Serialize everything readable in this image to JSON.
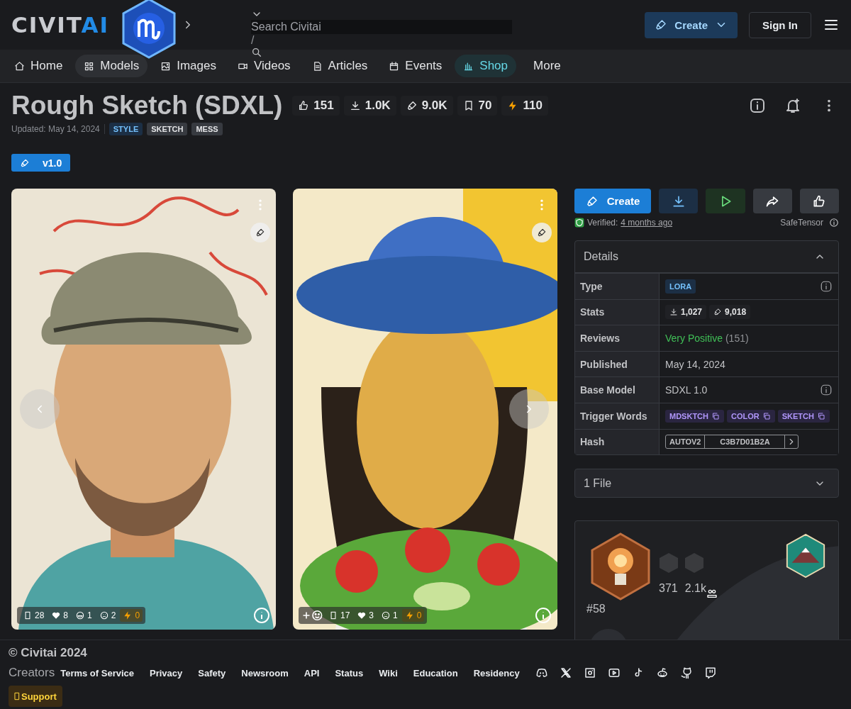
{
  "header": {
    "logo": {
      "main": "CIVIT",
      "accent": "AI"
    },
    "search": {
      "placeholder": "Search Civitai",
      "shortcut": "/"
    },
    "create_label": "Create",
    "sign_in_label": "Sign In"
  },
  "nav": [
    {
      "label": "Home",
      "kind": "plain",
      "selected": false
    },
    {
      "label": "Models",
      "kind": "plain",
      "selected": true
    },
    {
      "label": "Images",
      "kind": "plain",
      "selected": false
    },
    {
      "label": "Videos",
      "kind": "plain",
      "selected": false
    },
    {
      "label": "Articles",
      "kind": "plain",
      "selected": false
    },
    {
      "label": "Events",
      "kind": "plain",
      "selected": false
    },
    {
      "label": "Shop",
      "kind": "highlight",
      "selected": false
    },
    {
      "label": "More",
      "kind": "menu",
      "selected": false
    }
  ],
  "model": {
    "title": "Rough Sketch (SDXL)",
    "stats": [
      "151",
      "1.0K",
      "9.0K",
      "70",
      "110"
    ],
    "updated": "Updated: May 14, 2024",
    "tags": [
      {
        "label": "STYLE",
        "kind": "category"
      },
      {
        "label": "SKETCH",
        "kind": "tag"
      },
      {
        "label": "MESS",
        "kind": "tag"
      }
    ],
    "versions": [
      {
        "label": "v1.0",
        "selected": true
      }
    ]
  },
  "gallery": [
    {
      "add_reaction": false,
      "reactions": [
        {
          "kind": "unknown",
          "count": "28"
        },
        {
          "kind": "heart",
          "count": "8"
        },
        {
          "kind": "laugh",
          "count": "1"
        },
        {
          "kind": "cry",
          "count": "2"
        },
        {
          "kind": "buzz",
          "count": "0"
        }
      ]
    },
    {
      "add_reaction": true,
      "reactions": [
        {
          "kind": "unknown",
          "count": "17"
        },
        {
          "kind": "heart",
          "count": "3"
        },
        {
          "kind": "cry",
          "count": "1"
        },
        {
          "kind": "buzz",
          "count": "0"
        }
      ]
    }
  ],
  "actions": {
    "create_label": "Create",
    "buttons": [
      {
        "kind": "download"
      },
      {
        "kind": "play"
      },
      {
        "kind": "share"
      },
      {
        "kind": "like"
      }
    ]
  },
  "verified": {
    "label": "Verified:",
    "time": "4 months ago",
    "format": "SafeTensor"
  },
  "details": {
    "title": "Details",
    "expanded": true,
    "rows": [
      {
        "label": "Type",
        "kind": "badge",
        "value": "LORA",
        "info": true
      },
      {
        "label": "Stats",
        "kind": "stats",
        "info": false,
        "items": [
          "1,027",
          "9,018"
        ]
      },
      {
        "label": "Reviews",
        "kind": "review",
        "value": "Very Positive",
        "count": "(151)",
        "info": false
      },
      {
        "label": "Published",
        "kind": "text",
        "value": "May 14, 2024",
        "info": false
      },
      {
        "label": "Base Model",
        "kind": "text",
        "value": "SDXL 1.0",
        "info": true
      },
      {
        "label": "Trigger Words",
        "kind": "chips",
        "items": [
          "MDSKTCH",
          "COLOR",
          "SKETCH"
        ],
        "info": false
      },
      {
        "label": "Hash",
        "kind": "hash",
        "hash_type": "AUTOV2",
        "value": "C3B7D01B2A",
        "info": false
      }
    ]
  },
  "files": {
    "label": "1 File",
    "expanded": false
  },
  "creator": {
    "rank": "#58",
    "stats": [
      "371",
      "2.1k"
    ]
  },
  "footer": {
    "copyright": "© Civitai 2024",
    "creators": "Creators",
    "links": [
      "Terms of Service",
      "Privacy",
      "Safety",
      "Newsroom",
      "API",
      "Status",
      "Wiki",
      "Education",
      "Residency"
    ],
    "support": "Support"
  }
}
